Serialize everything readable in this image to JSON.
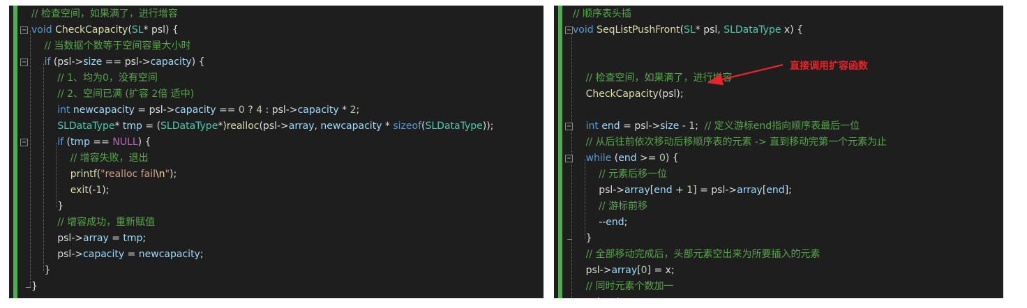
{
  "left_editor": {
    "lines": [
      [
        {
          "t": "// 检查空间，如果满了，进行增容",
          "c": "c"
        }
      ],
      [
        {
          "t": "void",
          "c": "k"
        },
        {
          "t": " ",
          "c": "p"
        },
        {
          "t": "CheckCapacity",
          "c": "f"
        },
        {
          "t": "(",
          "c": "p"
        },
        {
          "t": "SL",
          "c": "ty"
        },
        {
          "t": "* psl) {",
          "c": "p"
        }
      ],
      [
        {
          "t": "// 当数据个数等于空间容量大小时",
          "c": "c"
        }
      ],
      [
        {
          "t": "if",
          "c": "k"
        },
        {
          "t": " (psl->",
          "c": "p"
        },
        {
          "t": "size",
          "c": "v"
        },
        {
          "t": " == psl->",
          "c": "p"
        },
        {
          "t": "capacity",
          "c": "v"
        },
        {
          "t": ") {",
          "c": "p"
        }
      ],
      [
        {
          "t": "// 1、均为0，没有空间",
          "c": "c"
        }
      ],
      [
        {
          "t": "// 2、空间已满 (扩容 2倍 适中)",
          "c": "c"
        }
      ],
      [
        {
          "t": "int",
          "c": "k"
        },
        {
          "t": " ",
          "c": "p"
        },
        {
          "t": "newcapacity",
          "c": "v"
        },
        {
          "t": " = psl->",
          "c": "p"
        },
        {
          "t": "capacity",
          "c": "v"
        },
        {
          "t": " == ",
          "c": "p"
        },
        {
          "t": "0",
          "c": "n"
        },
        {
          "t": " ? ",
          "c": "p"
        },
        {
          "t": "4",
          "c": "n"
        },
        {
          "t": " : psl->",
          "c": "p"
        },
        {
          "t": "capacity",
          "c": "v"
        },
        {
          "t": " * ",
          "c": "p"
        },
        {
          "t": "2",
          "c": "n"
        },
        {
          "t": ";",
          "c": "p"
        }
      ],
      [
        {
          "t": "SLDataType",
          "c": "ty"
        },
        {
          "t": "* ",
          "c": "p"
        },
        {
          "t": "tmp",
          "c": "v"
        },
        {
          "t": " = (",
          "c": "p"
        },
        {
          "t": "SLDataType",
          "c": "ty"
        },
        {
          "t": "*)",
          "c": "p"
        },
        {
          "t": "realloc",
          "c": "f"
        },
        {
          "t": "(psl->",
          "c": "p"
        },
        {
          "t": "array",
          "c": "v"
        },
        {
          "t": ", ",
          "c": "p"
        },
        {
          "t": "newcapacity",
          "c": "v"
        },
        {
          "t": " * ",
          "c": "p"
        },
        {
          "t": "sizeof",
          "c": "k"
        },
        {
          "t": "(",
          "c": "p"
        },
        {
          "t": "SLDataType",
          "c": "ty"
        },
        {
          "t": "));",
          "c": "p"
        }
      ],
      [
        {
          "t": "if",
          "c": "k"
        },
        {
          "t": " (",
          "c": "p"
        },
        {
          "t": "tmp",
          "c": "v"
        },
        {
          "t": " == ",
          "c": "p"
        },
        {
          "t": "NULL",
          "c": "m"
        },
        {
          "t": ") {",
          "c": "p"
        }
      ],
      [
        {
          "t": "// 增容失败，退出",
          "c": "c"
        }
      ],
      [
        {
          "t": "printf",
          "c": "f"
        },
        {
          "t": "(",
          "c": "p"
        },
        {
          "t": "\"realloc fail",
          "c": "s"
        },
        {
          "t": "\\n",
          "c": "e"
        },
        {
          "t": "\"",
          "c": "s"
        },
        {
          "t": ");",
          "c": "p"
        }
      ],
      [
        {
          "t": "exit",
          "c": "f"
        },
        {
          "t": "(-",
          "c": "p"
        },
        {
          "t": "1",
          "c": "n"
        },
        {
          "t": ");",
          "c": "p"
        }
      ],
      [
        {
          "t": "}",
          "c": "p"
        }
      ],
      [
        {
          "t": "// 增容成功，重新赋值",
          "c": "c"
        }
      ],
      [
        {
          "t": "psl->",
          "c": "p"
        },
        {
          "t": "array",
          "c": "v"
        },
        {
          "t": " = ",
          "c": "p"
        },
        {
          "t": "tmp",
          "c": "v"
        },
        {
          "t": ";",
          "c": "p"
        }
      ],
      [
        {
          "t": "psl->",
          "c": "p"
        },
        {
          "t": "capacity",
          "c": "v"
        },
        {
          "t": " = ",
          "c": "p"
        },
        {
          "t": "newcapacity",
          "c": "v"
        },
        {
          "t": ";",
          "c": "p"
        }
      ],
      [
        {
          "t": "}",
          "c": "p"
        }
      ],
      [
        {
          "t": "}",
          "c": "p"
        }
      ]
    ]
  },
  "right_editor": {
    "lines": [
      [
        {
          "t": "// 顺序表头插",
          "c": "c"
        }
      ],
      [
        {
          "t": "void",
          "c": "k"
        },
        {
          "t": " ",
          "c": "p"
        },
        {
          "t": "SeqListPushFront",
          "c": "f"
        },
        {
          "t": "(",
          "c": "p"
        },
        {
          "t": "SL",
          "c": "ty"
        },
        {
          "t": "* psl, ",
          "c": "p"
        },
        {
          "t": "SLDataType",
          "c": "ty"
        },
        {
          "t": " x) {",
          "c": "p"
        }
      ],
      [],
      [],
      [
        {
          "t": "// 检查空间，如果满了，进行增容",
          "c": "c"
        }
      ],
      [
        {
          "t": "CheckCapacity",
          "c": "f"
        },
        {
          "t": "(psl);",
          "c": "p"
        }
      ],
      [],
      [
        {
          "t": "int",
          "c": "k"
        },
        {
          "t": " ",
          "c": "p"
        },
        {
          "t": "end",
          "c": "v"
        },
        {
          "t": " = psl->",
          "c": "p"
        },
        {
          "t": "size",
          "c": "v"
        },
        {
          "t": " - ",
          "c": "p"
        },
        {
          "t": "1",
          "c": "n"
        },
        {
          "t": ";  ",
          "c": "p"
        },
        {
          "t": "// 定义游标end指向顺序表最后一位",
          "c": "c"
        }
      ],
      [
        {
          "t": "// 从后往前依次移动后移顺序表的元素 -> 直到移动完第一个元素为止",
          "c": "c"
        }
      ],
      [
        {
          "t": "while",
          "c": "k"
        },
        {
          "t": " (",
          "c": "p"
        },
        {
          "t": "end",
          "c": "v"
        },
        {
          "t": " >= ",
          "c": "p"
        },
        {
          "t": "0",
          "c": "n"
        },
        {
          "t": ") {",
          "c": "p"
        }
      ],
      [
        {
          "t": "// 元素后移一位",
          "c": "c"
        }
      ],
      [
        {
          "t": "psl->",
          "c": "p"
        },
        {
          "t": "array",
          "c": "v"
        },
        {
          "t": "[",
          "c": "p"
        },
        {
          "t": "end",
          "c": "v"
        },
        {
          "t": " + ",
          "c": "p"
        },
        {
          "t": "1",
          "c": "n"
        },
        {
          "t": "] = psl->",
          "c": "p"
        },
        {
          "t": "array",
          "c": "v"
        },
        {
          "t": "[",
          "c": "p"
        },
        {
          "t": "end",
          "c": "v"
        },
        {
          "t": "];",
          "c": "p"
        }
      ],
      [
        {
          "t": "// 游标前移",
          "c": "c"
        }
      ],
      [
        {
          "t": "--",
          "c": "p"
        },
        {
          "t": "end",
          "c": "v"
        },
        {
          "t": ";",
          "c": "p"
        }
      ],
      [
        {
          "t": "}",
          "c": "p"
        }
      ],
      [
        {
          "t": "// 全部移动完成后，头部元素空出来为所要插入的元素",
          "c": "c"
        }
      ],
      [
        {
          "t": "psl->",
          "c": "p"
        },
        {
          "t": "array",
          "c": "v"
        },
        {
          "t": "[",
          "c": "p"
        },
        {
          "t": "0",
          "c": "n"
        },
        {
          "t": "] = x;",
          "c": "p"
        }
      ],
      [
        {
          "t": "// 同时元素个数加一",
          "c": "c"
        }
      ],
      [
        {
          "t": "psl->",
          "c": "p"
        },
        {
          "t": "size",
          "c": "v"
        },
        {
          "t": "++;",
          "c": "p"
        }
      ]
    ]
  },
  "annotation": {
    "text": "直接调用扩容函数",
    "color": "#e8232a"
  },
  "token_colors": {
    "k": "#569cd6",
    "c": "#57a64a",
    "ty": "#4ec9b0",
    "f": "#dcdcaa",
    "v": "#9cdcfe",
    "n": "#b5cea8",
    "s": "#d69d85",
    "e": "#ffd68f",
    "p": "#dcdcdc",
    "m": "#bd63c5"
  },
  "fold_icon_symbol": "⊟"
}
